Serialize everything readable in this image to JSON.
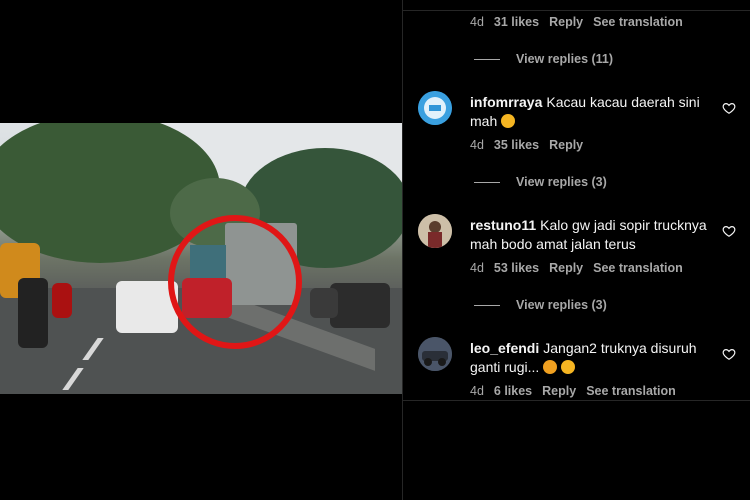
{
  "colors": {
    "background": "#000000",
    "text_primary": "#f5f5f5",
    "text_secondary": "#a8a8a8",
    "circle_highlight": "#e01616"
  },
  "media": {
    "description_icon": "video-frame"
  },
  "top_meta": {
    "time": "4d",
    "likes": "31 likes",
    "reply": "Reply",
    "translate": "See translation"
  },
  "top_view_replies": "View replies (11)",
  "comments": [
    {
      "username": "infomrraya",
      "text": "Kacau kacau daerah sini mah",
      "emoji": "laughing-emoji",
      "time": "4d",
      "likes": "35 likes",
      "reply": "Reply",
      "view_replies": "View replies (3)"
    },
    {
      "username": "restuno11",
      "text": "Kalo gw jadi sopir trucknya mah bodo amat jalan terus",
      "time": "4d",
      "likes": "53 likes",
      "reply": "Reply",
      "translate": "See translation",
      "view_replies": "View replies (3)"
    },
    {
      "username": "leo_efendi",
      "text": "Jangan2 truknya disuruh ganti rugi...",
      "emoji": "thinking-emoji",
      "time": "4d",
      "likes": "6 likes",
      "reply": "Reply",
      "translate": "See translation"
    }
  ]
}
